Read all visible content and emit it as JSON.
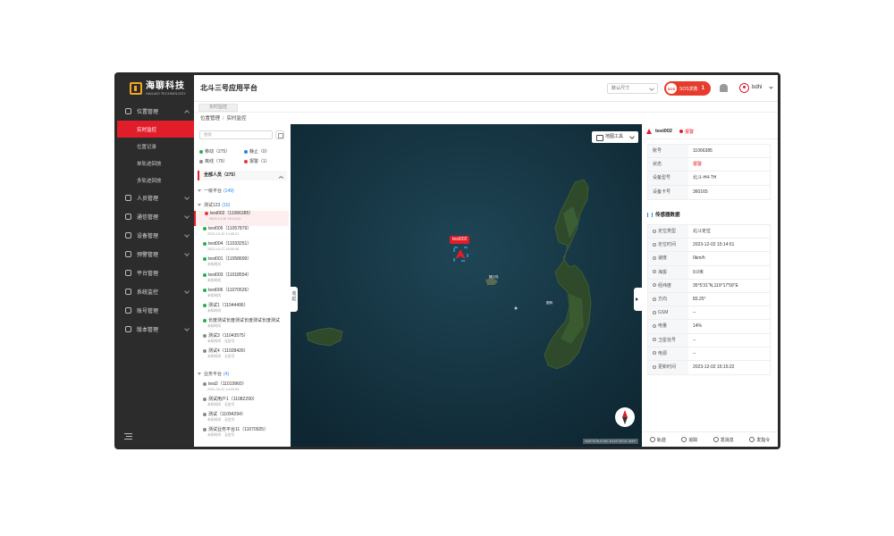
{
  "sidebar": {
    "logo_cn": "海聊科技",
    "logo_en": "HAILIAO TECHNOLOGY",
    "menu": [
      {
        "label": "位置管理",
        "icon": "location-icon"
      },
      {
        "label": "人员管理",
        "icon": "user-icon"
      },
      {
        "label": "通信管理",
        "icon": "message-icon"
      },
      {
        "label": "设备管理",
        "icon": "device-icon"
      },
      {
        "label": "预警管理",
        "icon": "alert-icon"
      },
      {
        "label": "平台管理",
        "icon": "platform-icon"
      },
      {
        "label": "系统监控",
        "icon": "monitor-icon"
      },
      {
        "label": "账号管理",
        "icon": "account-icon"
      },
      {
        "label": "版本管理",
        "icon": "version-icon"
      }
    ],
    "submenu": [
      "实时监控",
      "位置记录",
      "单轨迹回放",
      "多轨迹回放"
    ]
  },
  "topbar": {
    "title": "北斗三号应用平台",
    "size_select": "默认尺寸",
    "sos_icon": "SOS",
    "sos_label": "SOS求救",
    "sos_count": "1",
    "username": "bdhl"
  },
  "tabs": [
    "实时监控"
  ],
  "breadcrumb": [
    "位置管理",
    "实时监控"
  ],
  "device_panel": {
    "search_placeholder": "搜索",
    "legend": [
      {
        "label": "移动（275）",
        "color": "#21b14a"
      },
      {
        "label": "静止（0）",
        "color": "#1e88e5"
      },
      {
        "label": "离线（75）",
        "color": "#8a8a8a"
      },
      {
        "label": "报警（1）",
        "color": "#e53935"
      }
    ],
    "all_label": "全部人员（275）",
    "groups": [
      {
        "name": "一级平台",
        "count": "(149)"
      },
      {
        "name": "测试123",
        "count": "(10)"
      },
      {
        "name": "业务平台",
        "count": "(4)"
      }
    ],
    "devices": [
      {
        "name": "test002（11066385）",
        "sub": "2023-12-02 15:14:51",
        "color": "#e53935"
      },
      {
        "name": "test005（11057879）",
        "sub": "2023-10-30 14:55:21",
        "color": "#21b14a"
      },
      {
        "name": "test004（11033251）",
        "sub": "2023-10-27 15:55:36",
        "color": "#21b14a"
      },
      {
        "name": "test001（11058699）",
        "sub": "未知时间",
        "color": "#21b14a"
      },
      {
        "name": "test003（11018554）",
        "sub": "未知时间",
        "color": "#21b14a"
      },
      {
        "name": "test006（11070526）",
        "sub": "未知时间",
        "color": "#21b14a"
      },
      {
        "name": "测试1（11044496）",
        "sub": "未知时间",
        "color": "#21b14a"
      },
      {
        "name": "长度测试长度测试长度测试长度测试",
        "sub": "未知时间",
        "color": "#21b14a"
      },
      {
        "name": "测试3（11043575）",
        "sub": "未知时间　无信号",
        "color": "#8a8a8a"
      },
      {
        "name": "测试4（11028426）",
        "sub": "未知时间　无信号",
        "color": "#8a8a8a"
      },
      {
        "name": "test2（11019960）",
        "sub": "2021-10-21 14:02:05",
        "color": "#8a8a8a"
      },
      {
        "name": "测试用户1（11082290）",
        "sub": "未知时间　无信号",
        "color": "#8a8a8a"
      },
      {
        "name": "测试（11094294）",
        "sub": "未知时间　无信号",
        "color": "#8a8a8a"
      },
      {
        "name": "测试业务平台11（11070925）",
        "sub": "未知时间　无信号",
        "color": "#8a8a8a"
      }
    ]
  },
  "map": {
    "tools_label": "地图工具",
    "toggle_label": "收起",
    "marker_label": "test002",
    "place_labels": [
      "猪口岛",
      "图例"
    ],
    "coord_readout": "N35°5'25.4746\",E119°25'15.7849\""
  },
  "detail": {
    "name": "test002",
    "status": "报警",
    "basic": [
      {
        "k": "账号",
        "v": "11066385"
      },
      {
        "k": "状态",
        "v": "报警",
        "red": true
      },
      {
        "k": "设备型号",
        "v": "北斗-H4-TH"
      },
      {
        "k": "设备卡号",
        "v": "360165"
      }
    ],
    "sensor_title": "传感器数据",
    "sensor": [
      {
        "k": "定位类型",
        "v": "北斗定位"
      },
      {
        "k": "定位时间",
        "v": "2023-12-02 15:14:51"
      },
      {
        "k": "速度",
        "v": "0km/h"
      },
      {
        "k": "海拔",
        "v": "9.0米"
      },
      {
        "k": "经纬度",
        "v": "35°5'31\"N,119°17'59\"E"
      },
      {
        "k": "方向",
        "v": "83.25°"
      },
      {
        "k": "GSM",
        "v": "--"
      },
      {
        "k": "电量",
        "v": "14%"
      },
      {
        "k": "卫星信号",
        "v": "--"
      },
      {
        "k": "电源",
        "v": "--"
      },
      {
        "k": "更新时间",
        "v": "2023-12-02 15:15:22"
      }
    ],
    "actions": [
      "轨迹",
      "追踪",
      "发消息",
      "发指令"
    ]
  }
}
